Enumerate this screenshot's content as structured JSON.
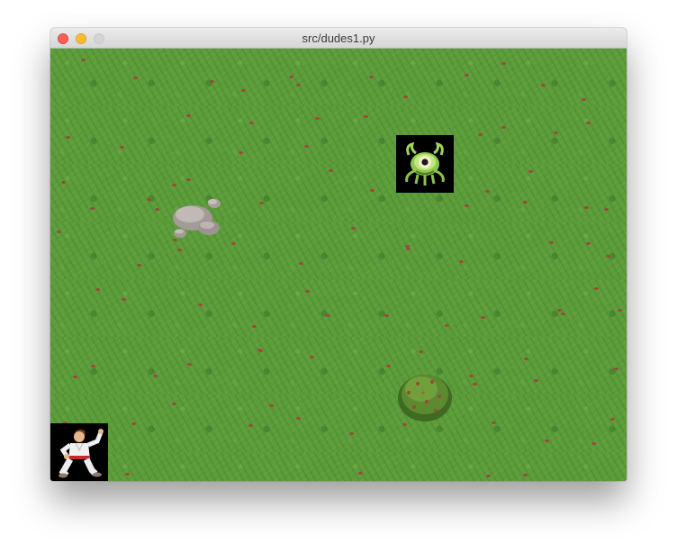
{
  "window": {
    "title": "src/dudes1.py",
    "buttons": {
      "close": {
        "icon": "close-traffic-light-icon",
        "color": "#fe5f57"
      },
      "minimize": {
        "icon": "minimize-traffic-light-icon",
        "color": "#febc2e"
      },
      "zoom": {
        "icon": "zoom-traffic-light-icon",
        "color": "#d4d4d4"
      }
    }
  },
  "game": {
    "grid": {
      "columns": 10,
      "rows": 7.5,
      "tile": "grass"
    },
    "colors": {
      "grass": "#5c9c3b",
      "flower": "#a5433a"
    },
    "entities": [
      {
        "name": "monster",
        "icon": "green-one-eyed-monster-icon"
      },
      {
        "name": "rock",
        "icon": "rock-pile-icon"
      },
      {
        "name": "bush",
        "icon": "bush-icon"
      },
      {
        "name": "player",
        "icon": "karate-fighter-icon"
      }
    ]
  }
}
